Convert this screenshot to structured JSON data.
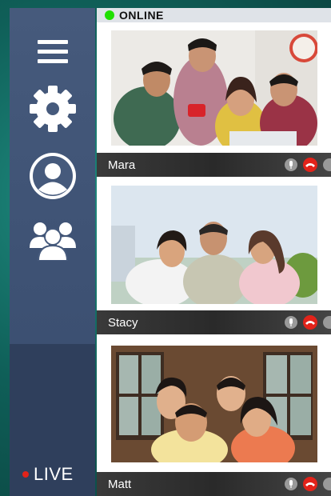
{
  "status": {
    "label": "ONLINE",
    "color": "#1fe000"
  },
  "sidebar": {
    "icons": [
      "menu-icon",
      "gear-icon",
      "user-icon",
      "group-icon"
    ],
    "live_label": "LIVE",
    "live_color": "#e2231a"
  },
  "calls": [
    {
      "name": "Mara"
    },
    {
      "name": "Stacy"
    },
    {
      "name": "Matt"
    }
  ],
  "controls": {
    "mute_icon": "microphone-icon",
    "end_icon": "end-call-icon",
    "end_color": "#e2231a"
  }
}
